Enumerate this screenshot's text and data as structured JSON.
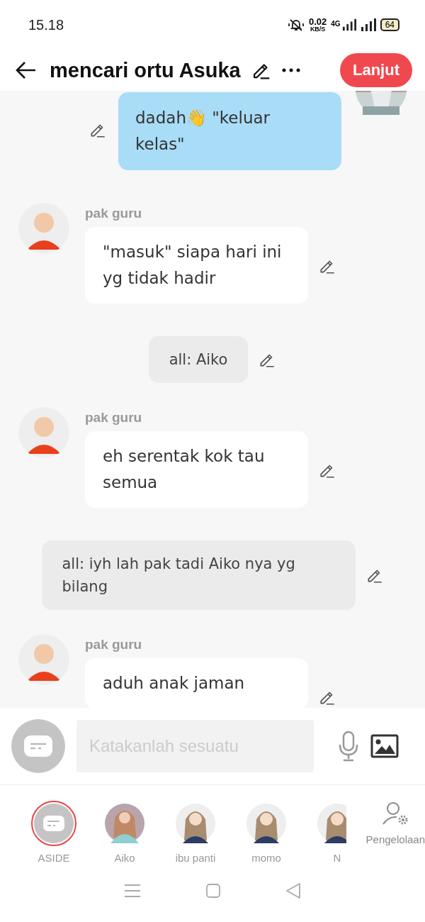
{
  "status_bar": {
    "time": "15.18",
    "speed": "0.02",
    "speed_unit": "KB/S",
    "network": "4G",
    "battery": "64"
  },
  "header": {
    "title": "mencari ortu Asuka",
    "next_button": "Lanjut"
  },
  "messages": [
    {
      "kind": "self",
      "text": "dadah👋 \"keluar kelas\""
    },
    {
      "kind": "character",
      "name": "pak guru",
      "text": "\"masuk\" siapa hari ini yg tidak hadir"
    },
    {
      "kind": "aside",
      "text": "all: Aiko"
    },
    {
      "kind": "character",
      "name": "pak guru",
      "text": "eh serentak kok tau semua"
    },
    {
      "kind": "aside",
      "text": "all: iyh lah pak tadi Aiko nya yg bilang"
    },
    {
      "kind": "character",
      "name": "pak guru",
      "text": "aduh anak jaman"
    }
  ],
  "composer": {
    "placeholder": "Katakanlah sesuatu"
  },
  "characters": [
    {
      "name": "ASIDE",
      "kind": "aside",
      "selected": true
    },
    {
      "name": "Aiko",
      "kind": "picture",
      "selected": false
    },
    {
      "name": "ibu panti",
      "kind": "figure",
      "selected": false
    },
    {
      "name": "momo",
      "kind": "figure",
      "selected": false
    },
    {
      "name": "N",
      "kind": "figure",
      "selected": false
    }
  ],
  "manage_label": "Pengelolaan"
}
